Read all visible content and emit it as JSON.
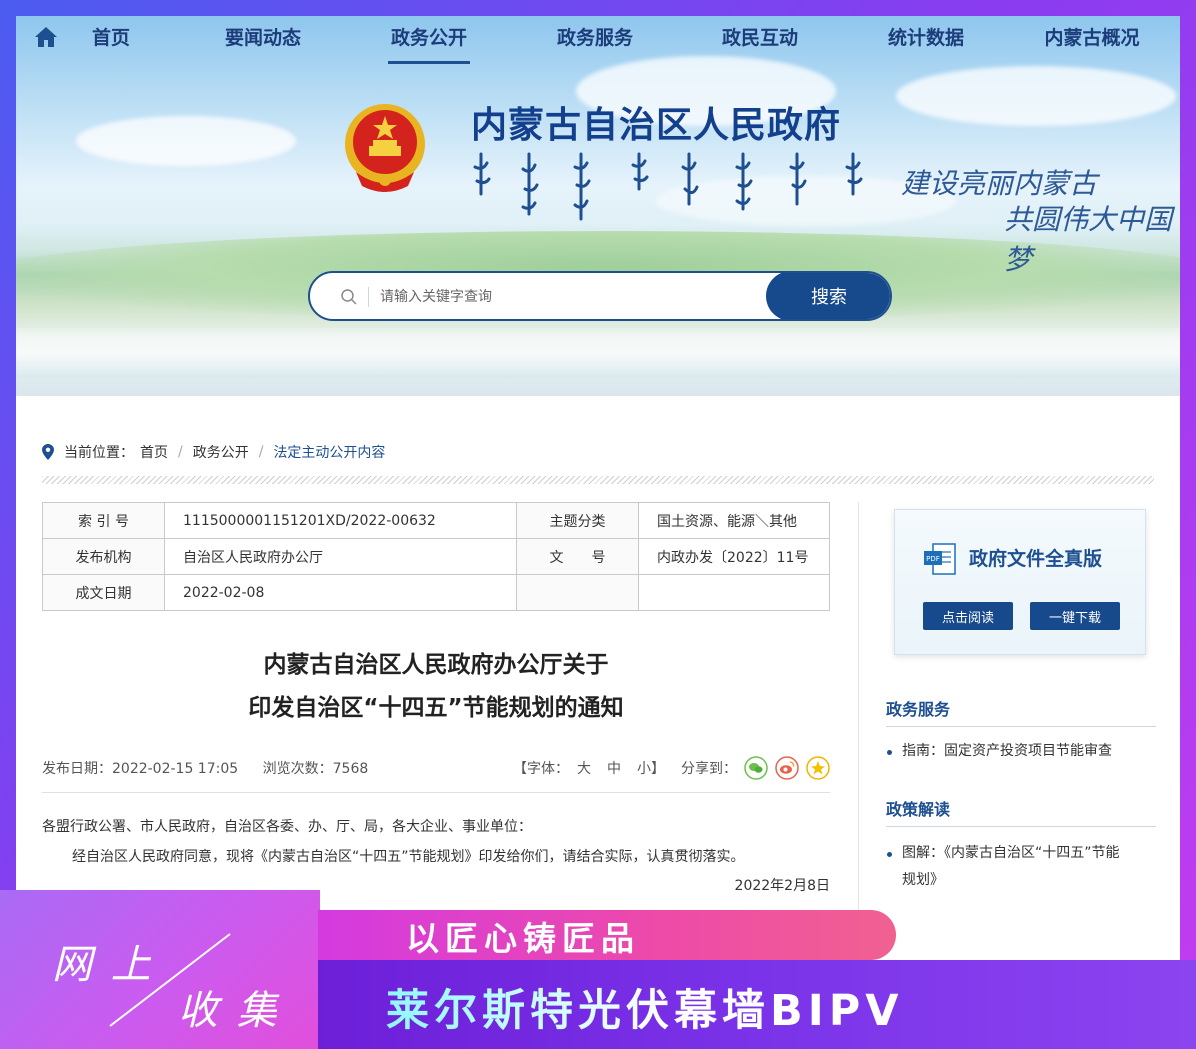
{
  "nav": {
    "items": [
      {
        "label": "首页"
      },
      {
        "label": "要闻动态"
      },
      {
        "label": "政务公开",
        "active": true
      },
      {
        "label": "政务服务"
      },
      {
        "label": "政民互动"
      },
      {
        "label": "统计数据"
      },
      {
        "label": "内蒙古概况"
      }
    ]
  },
  "header": {
    "site_title": "内蒙古自治区人民政府",
    "slogan_line1": "建设亮丽内蒙古",
    "slogan_line2": "共圆伟大中国梦"
  },
  "search": {
    "placeholder": "请输入关键字查询",
    "button_label": "搜索"
  },
  "breadcrumb": {
    "prefix": "当前位置：",
    "items": [
      "首页",
      "政务公开",
      "法定主动公开内容"
    ],
    "separator": "/"
  },
  "meta": {
    "index_label": "索 引 号",
    "index_value": "1115000001151201XD/2022-00632",
    "topic_label": "主题分类",
    "topic_value": "国土资源、能源＼其他",
    "publisher_label": "发布机构",
    "publisher_value": "自治区人民政府办公厅",
    "docno_label": "文　　号",
    "docno_value": "内政办发〔2022〕11号",
    "date_label": "成文日期",
    "date_value": "2022-02-08"
  },
  "article": {
    "title_line1": "内蒙古自治区人民政府办公厅关于",
    "title_line2": "印发自治区“十四五”节能规划的通知",
    "publish_date": "发布日期：2022-02-15 17:05",
    "view_count": "浏览次数：7568",
    "font_label": "【字体：",
    "font_large": "大",
    "font_medium": "中",
    "font_small": "小】",
    "share_label": "分享到：",
    "salutation": "各盟行政公署、市人民政府，自治区各委、办、厅、局，各大企业、事业单位：",
    "paragraph1": "经自治区人民政府同意，现将《内蒙古自治区“十四五”节能规划》印发给你们，请结合实际，认真贯彻落实。",
    "sign_date": "2022年2月8日"
  },
  "sidebar": {
    "download_title": "政府文件全真版",
    "read_button": "点击阅读",
    "download_button": "一键下载",
    "section1_title": "政务服务",
    "section1_items": [
      "指南：固定资产投资项目节能审查"
    ],
    "section2_title": "政策解读",
    "section2_item_line1": "图解：《内蒙古自治区“十四五”节能",
    "section2_item_line2": "规划》"
  },
  "promo": {
    "watermark_line1": "网 上",
    "watermark_line2": "收 集",
    "tagline": "以匠心铸匠品",
    "brand": "莱尔斯特光伏幕墙BIPV"
  },
  "colors": {
    "primary": "#174a8c",
    "title": "#13408c",
    "promo_purple": "#7a33e8",
    "promo_pink": "#ee4aa8"
  }
}
